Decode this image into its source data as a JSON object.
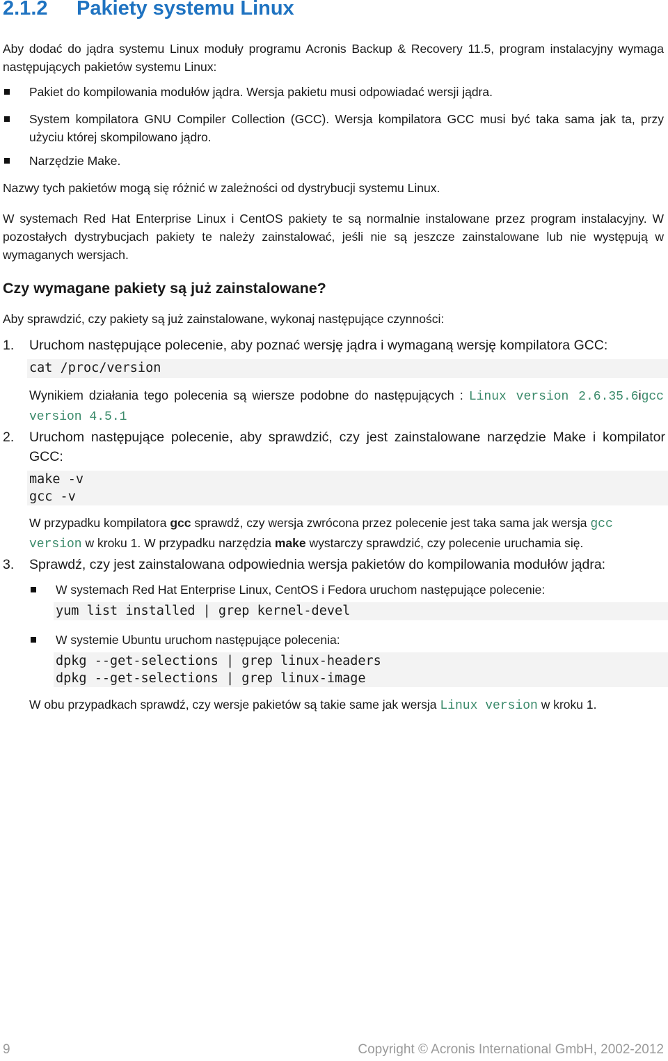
{
  "heading": {
    "number": "2.1.2",
    "title": "Pakiety systemu Linux"
  },
  "intro": "Aby dodać do jądra systemu Linux moduły programu Acronis Backup & Recovery 11.5, program instalacyjny wymaga następujących pakietów systemu Linux:",
  "requirements": [
    "Pakiet do kompilowania modułów jądra. Wersja pakietu musi odpowiadać wersji jądra.",
    "System kompilatora GNU Compiler Collection (GCC). Wersja kompilatora GCC musi być taka sama jak ta, przy użyciu której skompilowano jądro.",
    "Narzędzie Make."
  ],
  "note_names": "Nazwy tych pakietów mogą się różnić w zależności od dystrybucji systemu Linux.",
  "note_distros": "W systemach Red Hat Enterprise Linux i CentOS pakiety te są normalnie instalowane przez program instalacyjny. W pozostałych dystrybucjach pakiety te należy zainstalować, jeśli nie są jeszcze zainstalowane lub nie występują w wymaganych wersjach.",
  "subheading": "Czy wymagane pakiety są już zainstalowane?",
  "check_intro": "Aby sprawdzić, czy pakiety są już zainstalowane, wykonaj następujące czynności:",
  "steps": [
    {
      "number": "1.",
      "text": "Uruchom następujące polecenie, aby poznać wersję jądra i wymaganą wersję kompilatora GCC:",
      "code": "cat /proc/version",
      "result_prefix": "Wynikiem działania tego polecenia są wiersze podobne do następujących :",
      "result_code_1": "Linux version 2.6.35.6",
      "result_join": "i",
      "result_code_2": "gcc version 4.5.1"
    },
    {
      "number": "2.",
      "text": "Uruchom następujące polecenie, aby sprawdzić, czy jest zainstalowane narzędzie Make i kompilator GCC:",
      "code_lines": [
        "make -v",
        "gcc -v"
      ],
      "note_a": "W przypadku kompilatora",
      "note_b": "gcc",
      "note_c": "sprawdź, czy wersja zwrócona przez polecenie jest taka sama jak wersja",
      "note_code": "gcc version",
      "note_d": "w kroku 1. W przypadku narzędzia",
      "note_e": "make",
      "note_f": "wystarczy sprawdzić, czy polecenie uruchamia się."
    },
    {
      "number": "3.",
      "text": "Sprawdź, czy jest zainstalowana odpowiednia wersja pakietów do kompilowania modułów jądra:",
      "subitems": [
        {
          "text": "W systemach Red Hat Enterprise Linux, CentOS i Fedora uruchom następujące polecenie:",
          "code_lines": [
            "yum list installed | grep kernel-devel"
          ]
        },
        {
          "text": "W systemie Ubuntu uruchom następujące polecenia:",
          "code_lines": [
            "dpkg --get-selections | grep linux-headers",
            "dpkg --get-selections | grep linux-image"
          ]
        }
      ],
      "closing_a": "W obu przypadkach sprawdź, czy wersje pakietów są takie same jak wersja",
      "closing_code": "Linux version",
      "closing_b": "w kroku 1."
    }
  ],
  "footer": {
    "page_number": "9",
    "copyright": "Copyright © Acronis International GmbH, 2002-2012"
  }
}
